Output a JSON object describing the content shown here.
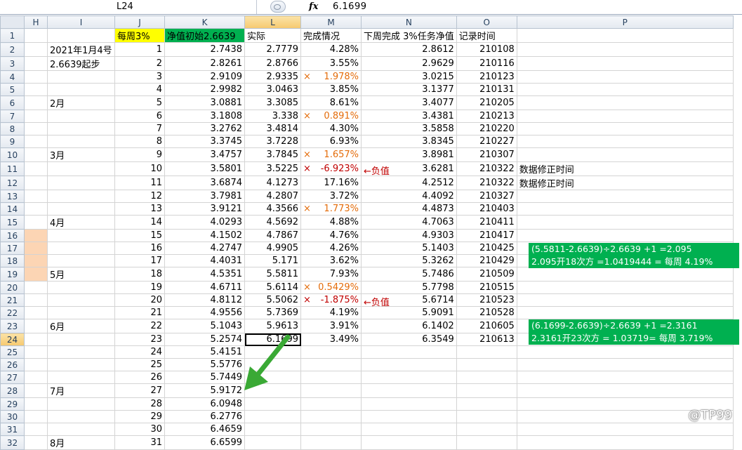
{
  "formula_bar": {
    "name_box": "L24",
    "fx": "fx",
    "formula": "6.1699"
  },
  "columns": [
    "H",
    "I",
    "J",
    "K",
    "L",
    "M",
    "N",
    "O",
    "P"
  ],
  "selected_column": "L",
  "selected_row": "24",
  "header_row": {
    "J": "每周3%",
    "K": "净值初始2.6639",
    "L": "实际",
    "M": "完成情况",
    "N": "下周完成 3%任务净值",
    "O": "记录时间"
  },
  "rows": [
    {
      "r": "2",
      "I": "2021年1月4号",
      "J": "1",
      "K": "2.7438",
      "L": "2.7779",
      "M": "4.28%",
      "N": "2.8612",
      "O": "210108"
    },
    {
      "r": "3",
      "I": "2.6639起步",
      "J": "2",
      "K": "2.8261",
      "L": "2.8766",
      "M": "3.55%",
      "N": "2.9629",
      "O": "210116"
    },
    {
      "r": "4",
      "J": "3",
      "K": "2.9109",
      "L": "2.9335",
      "M": "1.978%",
      "Mx": "×",
      "N": "3.0215",
      "O": "210123"
    },
    {
      "r": "5",
      "J": "4",
      "K": "2.9982",
      "L": "3.0463",
      "M": "3.85%",
      "N": "3.1377",
      "O": "210131"
    },
    {
      "r": "6",
      "I": "2月",
      "J": "5",
      "K": "3.0881",
      "L": "3.3085",
      "M": "8.61%",
      "N": "3.4077",
      "O": "210205"
    },
    {
      "r": "7",
      "J": "6",
      "K": "3.1808",
      "L": "3.338",
      "M": "0.891%",
      "Mx": "×",
      "N": "3.4381",
      "O": "210213"
    },
    {
      "r": "8",
      "J": "7",
      "K": "3.2762",
      "L": "3.4814",
      "M": "4.30%",
      "N": "3.5858",
      "O": "210220"
    },
    {
      "r": "9",
      "J": "8",
      "K": "3.3745",
      "L": "3.7228",
      "M": "6.93%",
      "N": "3.8345",
      "O": "210227"
    },
    {
      "r": "10",
      "I": "3月",
      "J": "9",
      "K": "3.4757",
      "L": "3.7845",
      "M": "1.657%",
      "Mx": "×",
      "N": "3.8981",
      "O": "210307"
    },
    {
      "r": "11",
      "J": "10",
      "K": "3.5801",
      "L": "3.5225",
      "M": "-6.923%",
      "Mx": "×",
      "Mred": "1",
      "Nann": "←负值",
      "N": "3.6281",
      "O": "210322",
      "P": "数据修正时间"
    },
    {
      "r": "12",
      "J": "11",
      "K": "3.6874",
      "L": "4.1273",
      "M": "17.16%",
      "N": "4.2512",
      "O": "210322",
      "P": "数据修正时间"
    },
    {
      "r": "13",
      "J": "12",
      "K": "3.7981",
      "L": "4.2807",
      "M": "3.72%",
      "N": "4.4092",
      "O": "210327"
    },
    {
      "r": "14",
      "J": "13",
      "K": "3.9121",
      "L": "4.3566",
      "M": "1.773%",
      "Mx": "×",
      "N": "4.4873",
      "O": "210403"
    },
    {
      "r": "15",
      "I": "4月",
      "J": "14",
      "K": "4.0293",
      "L": "4.5692",
      "M": "4.88%",
      "N": "4.7063",
      "O": "210411"
    },
    {
      "r": "16",
      "J": "15",
      "K": "4.1502",
      "L": "4.7867",
      "M": "4.76%",
      "N": "4.9303",
      "O": "210417",
      "Hpeach": "1"
    },
    {
      "r": "17",
      "J": "16",
      "K": "4.2747",
      "L": "4.9905",
      "M": "4.26%",
      "N": "5.1403",
      "O": "210425",
      "Hpeach": "1"
    },
    {
      "r": "18",
      "J": "17",
      "K": "4.4031",
      "L": "5.171",
      "M": "3.62%",
      "N": "5.3262",
      "O": "210429",
      "Hpeach": "1"
    },
    {
      "r": "19",
      "I": "5月",
      "J": "18",
      "K": "4.5351",
      "L": "5.5811",
      "M": "7.93%",
      "N": "5.7486",
      "O": "210509",
      "Hpeach": "1"
    },
    {
      "r": "20",
      "J": "19",
      "K": "4.6711",
      "L": "5.6114",
      "M": "0.5429%",
      "Mx": "×",
      "N": "5.7798",
      "O": "210515"
    },
    {
      "r": "21",
      "J": "20",
      "K": "4.8112",
      "L": "5.5062",
      "M": "-1.875%",
      "Mx": "×",
      "Mred": "1",
      "Nann": "←负值",
      "N": "5.6714",
      "O": "210523"
    },
    {
      "r": "22",
      "J": "21",
      "K": "4.9556",
      "L": "5.7369",
      "M": "4.19%",
      "N": "5.9091",
      "O": "210528"
    },
    {
      "r": "23",
      "I": "6月",
      "J": "22",
      "K": "5.1043",
      "L": "5.9613",
      "M": "3.91%",
      "N": "6.1402",
      "O": "210605"
    },
    {
      "r": "24",
      "J": "23",
      "K": "5.2574",
      "L": "6.1699",
      "M": "3.49%",
      "N": "6.3549",
      "O": "210613"
    },
    {
      "r": "25",
      "J": "24",
      "K": "5.4151"
    },
    {
      "r": "26",
      "J": "25",
      "K": "5.5776"
    },
    {
      "r": "27",
      "J": "26",
      "K": "5.7449"
    },
    {
      "r": "28",
      "I": "7月",
      "J": "27",
      "K": "5.9172"
    },
    {
      "r": "29",
      "J": "28",
      "K": "6.0948"
    },
    {
      "r": "30",
      "J": "29",
      "K": "6.2776"
    },
    {
      "r": "31",
      "J": "30",
      "K": "6.4659"
    },
    {
      "r": "32",
      "I": "8月",
      "J": "31",
      "K": "6.6599"
    }
  ],
  "notes": [
    {
      "line1": "(5.5811-2.6639)÷2.6639 +1 =2.095",
      "line2": "2.095开18次方 =1.0419444 = 每周 4.19%"
    },
    {
      "line1": "(6.1699-2.6639)÷2.6639 +1 =2.3161",
      "line2": "2.3161开23次方 = 1.03719= 每周 3.719%"
    }
  ],
  "watermark": "@TP99",
  "colors": {
    "green": "#00b050",
    "yellow": "#ffff00",
    "peach": "#fcd5b4",
    "orange": "#e46c0a",
    "red": "#c00000"
  }
}
